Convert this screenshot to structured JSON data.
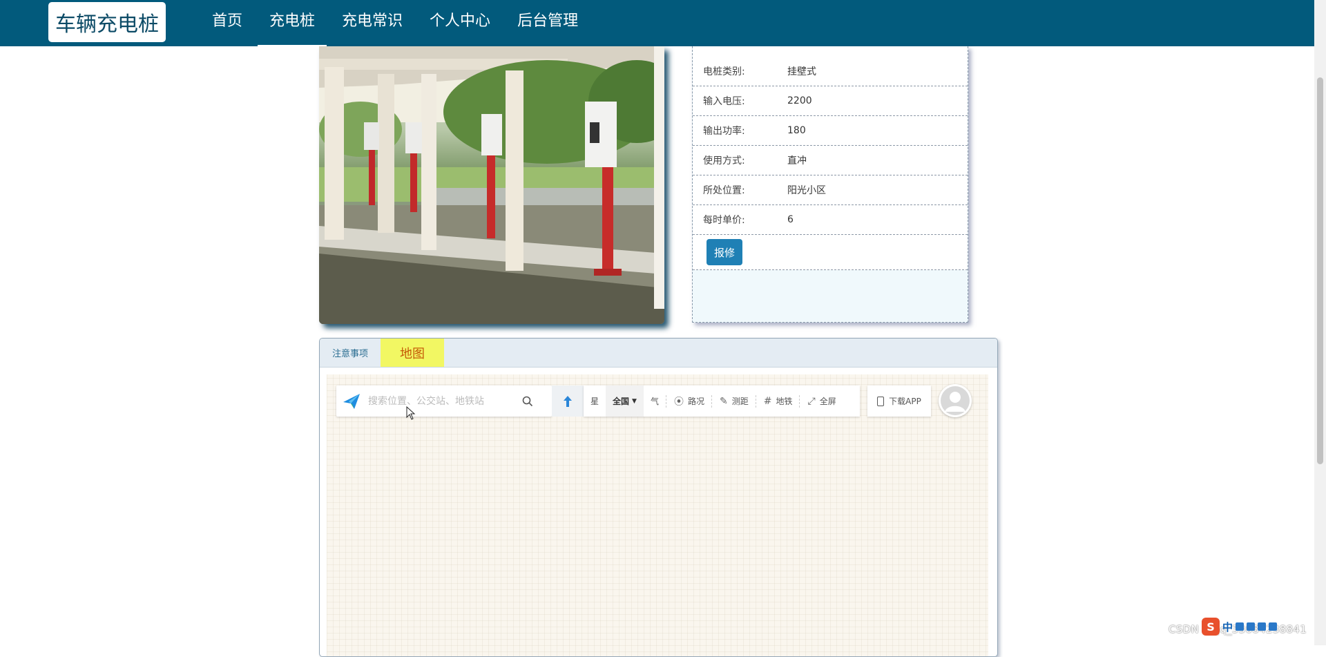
{
  "brand": "车辆充电桩",
  "nav": [
    {
      "label": "首页",
      "active": false
    },
    {
      "label": "充电桩",
      "active": true
    },
    {
      "label": "充电常识",
      "active": false
    },
    {
      "label": "个人中心",
      "active": false
    },
    {
      "label": "后台管理",
      "active": false
    }
  ],
  "details": {
    "rows": [
      {
        "label": "电桩类别:",
        "value": "挂壁式"
      },
      {
        "label": "输入电压:",
        "value": "2200"
      },
      {
        "label": "输出功率:",
        "value": "180"
      },
      {
        "label": "使用方式:",
        "value": "直冲"
      },
      {
        "label": "所处位置:",
        "value": "阳光小区"
      },
      {
        "label": "每时单价:",
        "value": "6"
      }
    ],
    "repair_button": "报修"
  },
  "tabs": [
    {
      "label": "注意事项",
      "active": false
    },
    {
      "label": "地图",
      "active": true
    }
  ],
  "map": {
    "search_placeholder": "搜索位置、公交站、地铁站",
    "route_partial": "星",
    "region": "全国",
    "weather_partial": "气",
    "tools": [
      "路况",
      "测距",
      "地铁",
      "全屏"
    ],
    "app_button": "下载APP"
  },
  "tray": {
    "watermark": "CSDN @qq_33084238841",
    "ime_label": "中"
  },
  "colors": {
    "nav_bg": "#025a7c",
    "button": "#1f80b5",
    "active_tab": "#f2f763"
  }
}
